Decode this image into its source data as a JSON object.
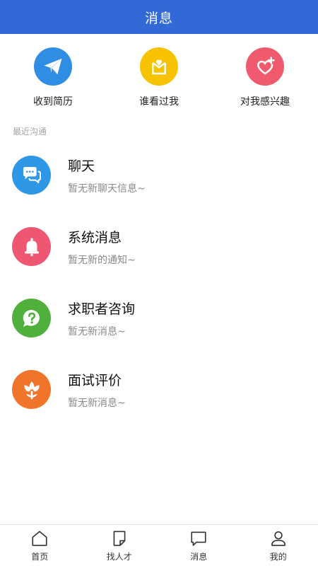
{
  "header": {
    "title": "消息"
  },
  "quick_actions": [
    {
      "label": "收到简历",
      "icon": "paper-plane-icon",
      "color": "#2f8de4"
    },
    {
      "label": "谁看过我",
      "icon": "envelope-heart-icon",
      "color": "#f7c300"
    },
    {
      "label": "对我感兴趣",
      "icon": "heart-plus-icon",
      "color": "#ef5a6e"
    }
  ],
  "section": {
    "title": "最近沟通"
  },
  "conversations": [
    {
      "title": "聊天",
      "subtitle": "暂无新聊天信息~",
      "icon": "chat-bubbles-icon",
      "color": "#2e97e6"
    },
    {
      "title": "系统消息",
      "subtitle": "暂无新的通知~",
      "icon": "bell-icon",
      "color": "#ee5671"
    },
    {
      "title": "求职者咨询",
      "subtitle": "暂无新消息~",
      "icon": "question-bubble-icon",
      "color": "#4fb03c"
    },
    {
      "title": "面试评价",
      "subtitle": "暂无新消息~",
      "icon": "flower-icon",
      "color": "#f07429"
    }
  ],
  "tabbar": {
    "tabs": [
      {
        "label": "首页",
        "icon": "home-icon"
      },
      {
        "label": "找人才",
        "icon": "document-icon"
      },
      {
        "label": "消息",
        "icon": "message-icon"
      },
      {
        "label": "我的",
        "icon": "user-icon"
      }
    ]
  }
}
